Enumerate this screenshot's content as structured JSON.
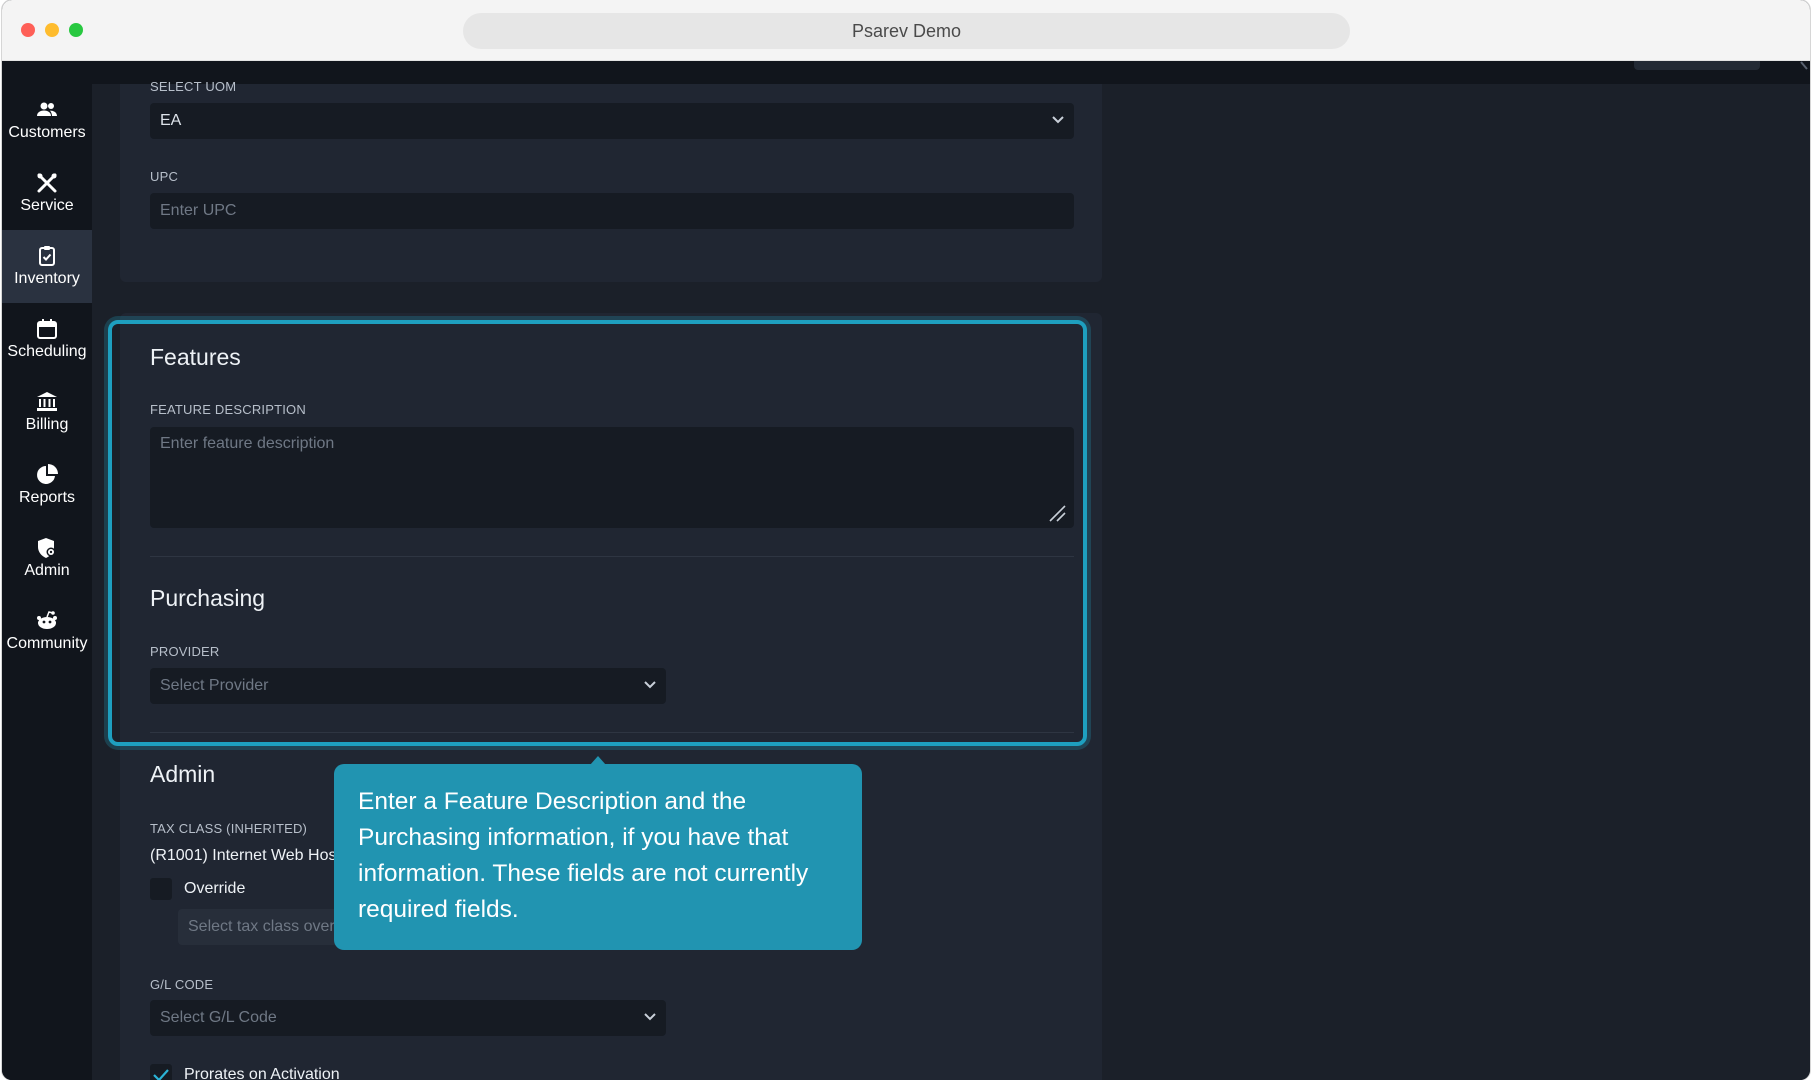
{
  "window": {
    "title": "Psarev Demo"
  },
  "sidebar": {
    "items": [
      {
        "label": "Customers",
        "icon": "people-icon",
        "active": false
      },
      {
        "label": "Service",
        "icon": "tools-icon",
        "active": false
      },
      {
        "label": "Inventory",
        "icon": "clipboard-check-icon",
        "active": true
      },
      {
        "label": "Scheduling",
        "icon": "calendar-icon",
        "active": false
      },
      {
        "label": "Billing",
        "icon": "bank-icon",
        "active": false
      },
      {
        "label": "Reports",
        "icon": "pie-chart-icon",
        "active": false
      },
      {
        "label": "Admin",
        "icon": "user-gear-icon",
        "active": false
      },
      {
        "label": "Community",
        "icon": "community-icon",
        "active": false
      }
    ]
  },
  "form": {
    "uom": {
      "label": "SELECT UOM",
      "value": "EA"
    },
    "upc": {
      "label": "UPC",
      "placeholder": "Enter UPC"
    },
    "features": {
      "heading": "Features",
      "description_label": "FEATURE DESCRIPTION",
      "description_placeholder": "Enter feature description"
    },
    "purchasing": {
      "heading": "Purchasing",
      "provider_label": "PROVIDER",
      "provider_placeholder": "Select Provider"
    },
    "admin": {
      "heading": "Admin",
      "tax_class_label": "TAX CLASS (INHERITED)",
      "tax_class_value": "(R1001) Internet Web Hos",
      "override_label": "Override",
      "tax_override_placeholder": "Select tax class over",
      "gl_code_label": "G/L CODE",
      "gl_code_placeholder": "Select G/L Code",
      "prorates_label": "Prorates on Activation",
      "prorates_checked": true
    }
  },
  "tooltip": {
    "text": "Enter a Feature Description and the Purchasing information, if you have that information. These fields are not currently required fields."
  },
  "colors": {
    "accent": "#2194b1",
    "highlight_border": "#1e9fbf",
    "background": "#1b2029",
    "panel": "#202632",
    "sidebar": "#11151c"
  }
}
